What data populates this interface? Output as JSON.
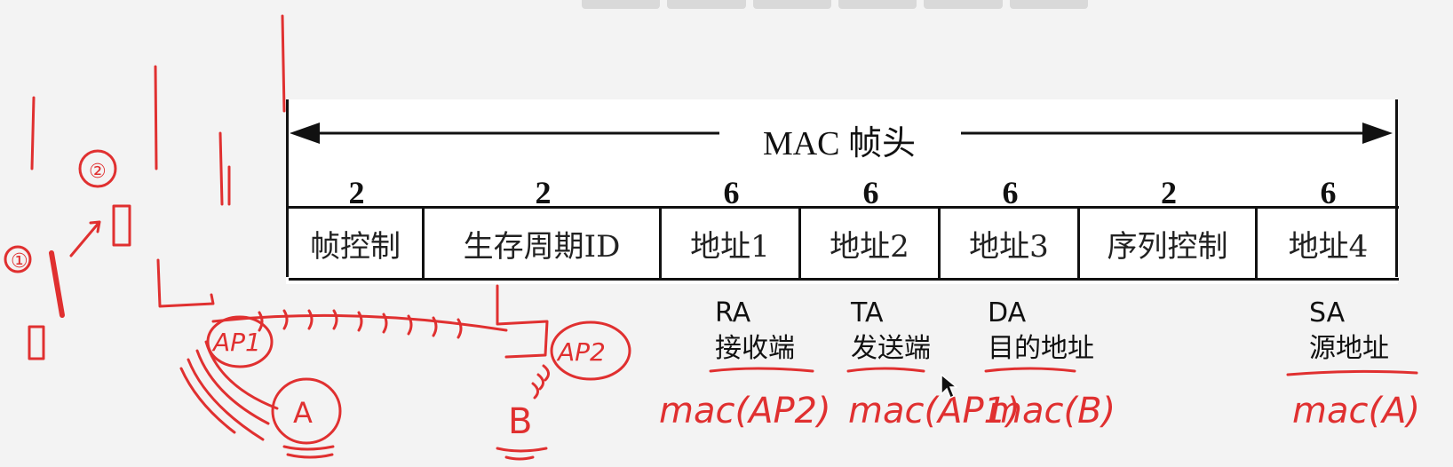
{
  "header": {
    "title": "MAC 帧头"
  },
  "fields": [
    {
      "size": "2",
      "label": "帧控制"
    },
    {
      "size": "2",
      "label": "生存周期ID"
    },
    {
      "size": "6",
      "label": "地址1"
    },
    {
      "size": "6",
      "label": "地址2"
    },
    {
      "size": "6",
      "label": "地址3"
    },
    {
      "size": "2",
      "label": "序列控制"
    },
    {
      "size": "6",
      "label": "地址4"
    }
  ],
  "annotations": [
    {
      "abbr": "RA",
      "meaning": "接收端",
      "handwritten": "mac(AP2)"
    },
    {
      "abbr": "TA",
      "meaning": "发送端",
      "handwritten": "mac(AP1)"
    },
    {
      "abbr": "DA",
      "meaning": "目的地址",
      "handwritten": "mac(B)"
    },
    {
      "abbr": "SA",
      "meaning": "源地址",
      "handwritten": "mac(A)"
    }
  ],
  "sketch_labels": [
    "①",
    "②",
    "AP1",
    "AP2",
    "A",
    "B"
  ],
  "colors": {
    "ink": "#111111",
    "pen": "#e03030",
    "background": "#f3f3f3"
  }
}
